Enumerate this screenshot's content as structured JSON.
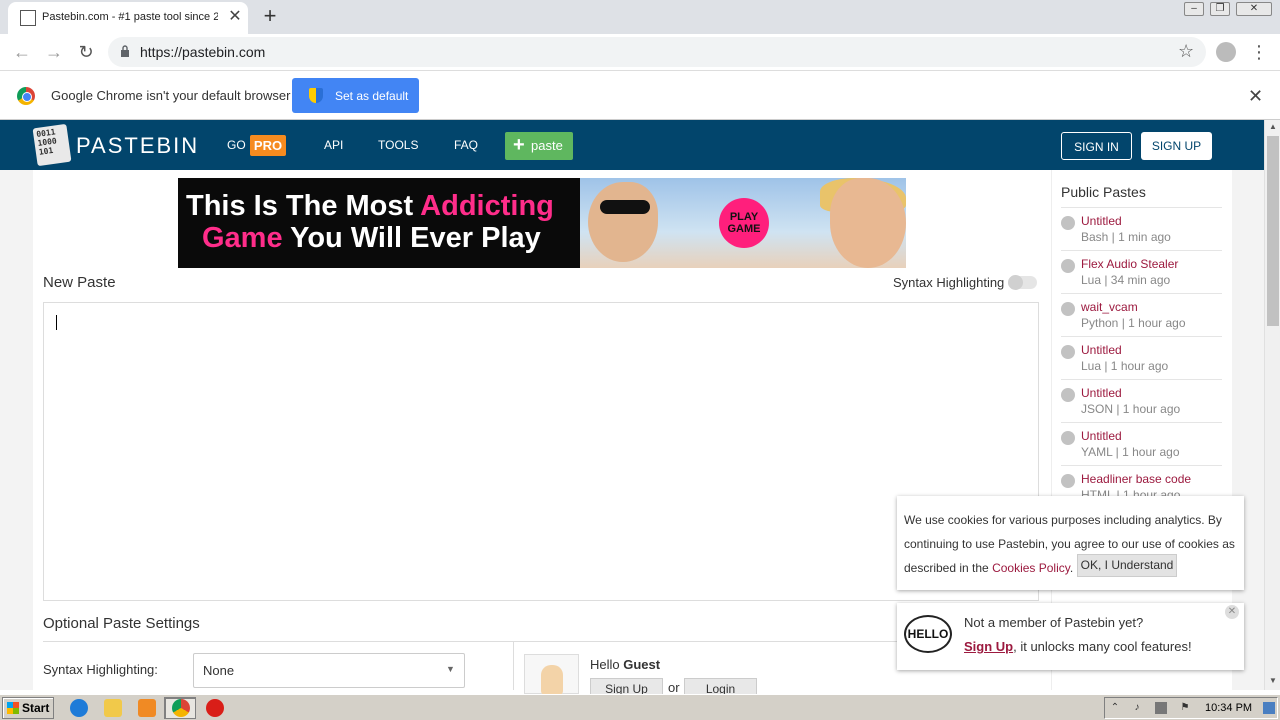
{
  "browser": {
    "tab_title": "Pastebin.com - #1 paste tool since 2",
    "tab_close": "✕",
    "new_tab": "+",
    "url": "https://pastebin.com",
    "back": "←",
    "forward": "→",
    "reload": "↻",
    "star": "☆",
    "menu": "⋮",
    "win_min": "–",
    "win_max": "❐",
    "win_close": "✕"
  },
  "infobar": {
    "message": "Google Chrome isn't your default browser",
    "button": "Set as default",
    "close": "✕"
  },
  "pastebin_nav": {
    "logo_text": "PASTEBIN",
    "logo_icon_text": "0011\n1000\n101",
    "go": "GO",
    "pro": "PRO",
    "api": "API",
    "tools": "TOOLS",
    "faq": "FAQ",
    "paste_plus": "+",
    "paste": "paste",
    "sign_in": "SIGN IN",
    "sign_up": "SIGN UP"
  },
  "ad": {
    "line1_white": "This Is The Most ",
    "line1_pink": "Addicting",
    "line2_pink": "Game",
    "line2_white": " You Will Ever Play",
    "badge": "PLAY GAME"
  },
  "new_paste": {
    "title": "New Paste",
    "syntax_toggle_label": "Syntax Highlighting"
  },
  "optional_settings": {
    "title": "Optional Paste Settings",
    "syntax_label": "Syntax Highlighting:",
    "syntax_value": "None",
    "syntax_arrow": "▼"
  },
  "guest": {
    "hello": "Hello ",
    "name": "Guest",
    "sign_up": "Sign Up",
    "or": "or",
    "login": "Login"
  },
  "public_pastes": {
    "title": "Public Pastes",
    "items": [
      {
        "title": "Untitled",
        "meta": "Bash | 1 min ago"
      },
      {
        "title": "Flex Audio Stealer",
        "meta": "Lua | 34 min ago"
      },
      {
        "title": "wait_vcam",
        "meta": "Python | 1 hour ago"
      },
      {
        "title": "Untitled",
        "meta": "Lua | 1 hour ago"
      },
      {
        "title": "Untitled",
        "meta": "JSON | 1 hour ago"
      },
      {
        "title": "Untitled",
        "meta": "YAML | 1 hour ago"
      },
      {
        "title": "Headliner base code",
        "meta": "HTML | 1 hour ago"
      }
    ]
  },
  "cookie": {
    "text_before": "We use cookies for various purposes including analytics. By continuing to use Pastebin, you agree to our use of cookies as described in the ",
    "link": "Cookies Policy",
    "text_after": ".",
    "button": "OK, I Understand"
  },
  "member_popup": {
    "bubble": "HELLO",
    "line1": "Not a member of Pastebin yet?",
    "signup": "Sign Up",
    "line2_rest": ", it unlocks many cool features!",
    "close": "✕"
  },
  "scrollbar": {
    "up": "▲",
    "down": "▼"
  },
  "taskbar": {
    "start": "Start",
    "clock": "10:34 PM"
  },
  "colors": {
    "pastebin_header": "#02456c",
    "pro_badge": "#f68b1f",
    "paste_button": "#5fb75f",
    "link_red": "#9c1a3f",
    "chrome_blue": "#4285f4"
  }
}
